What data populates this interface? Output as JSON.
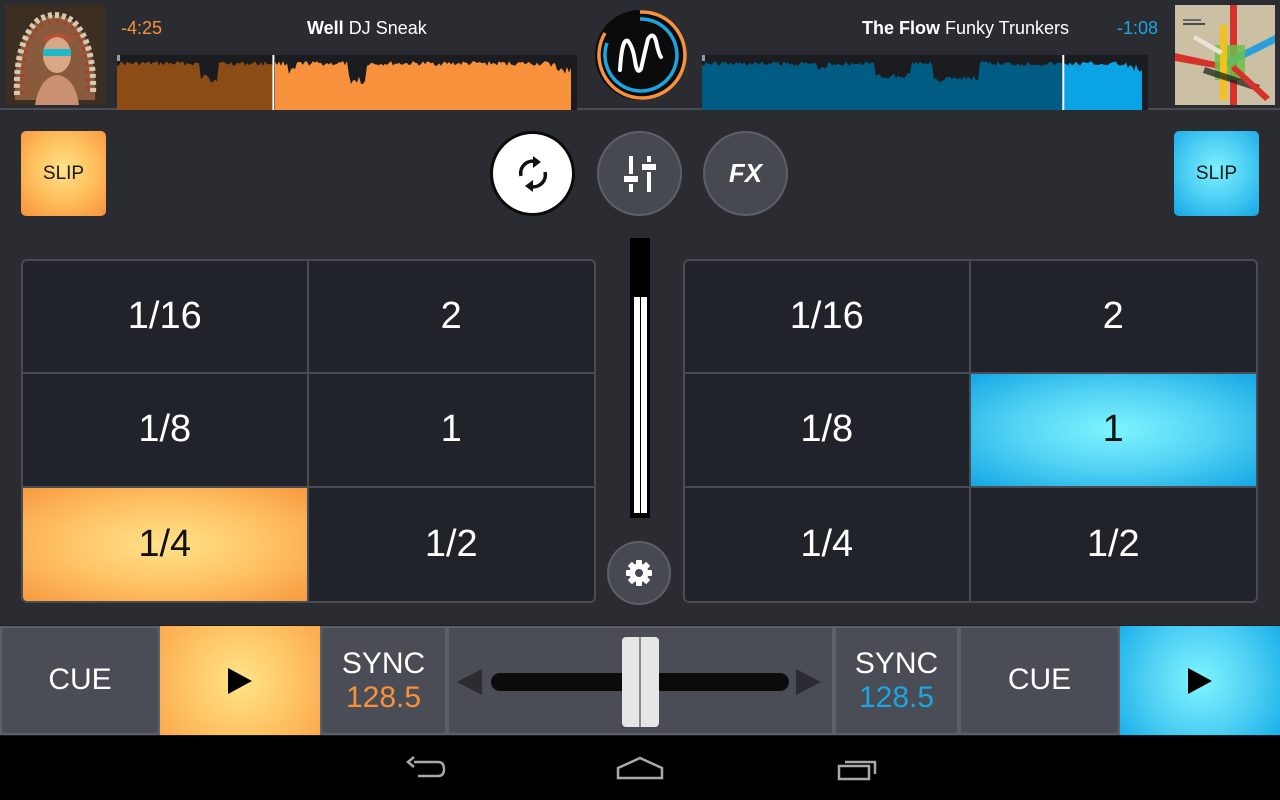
{
  "deck_left": {
    "remaining_time": "-4:25",
    "track_title": "Well",
    "track_artist": "DJ Sneak",
    "cover_art": "album-cover-headdress",
    "progress": 0.34,
    "accent_color": "#f7913b",
    "slip_label": "SLIP",
    "pads": [
      "1/16",
      "2",
      "1/8",
      "1",
      "1/4",
      "1/2"
    ],
    "active_pad": "1/4",
    "cue_label": "CUE",
    "play_icon": "play-icon",
    "sync_label": "SYNC",
    "bpm": "128.5"
  },
  "deck_right": {
    "remaining_time": "-1:08",
    "track_title": "The Flow",
    "track_artist": "Funky Trunkers",
    "cover_art": "album-cover-closed-expansion",
    "progress": 0.81,
    "accent_color": "#1aa6e0",
    "slip_label": "SLIP",
    "pads": [
      "1/16",
      "2",
      "1/8",
      "1",
      "1/4",
      "1/2"
    ],
    "active_pad": "1",
    "cue_label": "CUE",
    "play_icon": "play-icon",
    "sync_label": "SYNC",
    "bpm": "128.5"
  },
  "center": {
    "logo": "waveform-logo-icon",
    "mode_buttons": [
      {
        "name": "loop",
        "icon": "loop-icon",
        "active": true
      },
      {
        "name": "mixer",
        "icon": "mixer-sliders-icon",
        "active": false
      },
      {
        "name": "fx",
        "label": "FX",
        "active": false
      }
    ],
    "volume_meter_level": 0.8,
    "settings_icon": "gear-icon",
    "crossfader_position": 0.5
  },
  "system_nav": {
    "back_icon": "back-icon",
    "home_icon": "home-icon",
    "recents_icon": "recents-icon"
  }
}
